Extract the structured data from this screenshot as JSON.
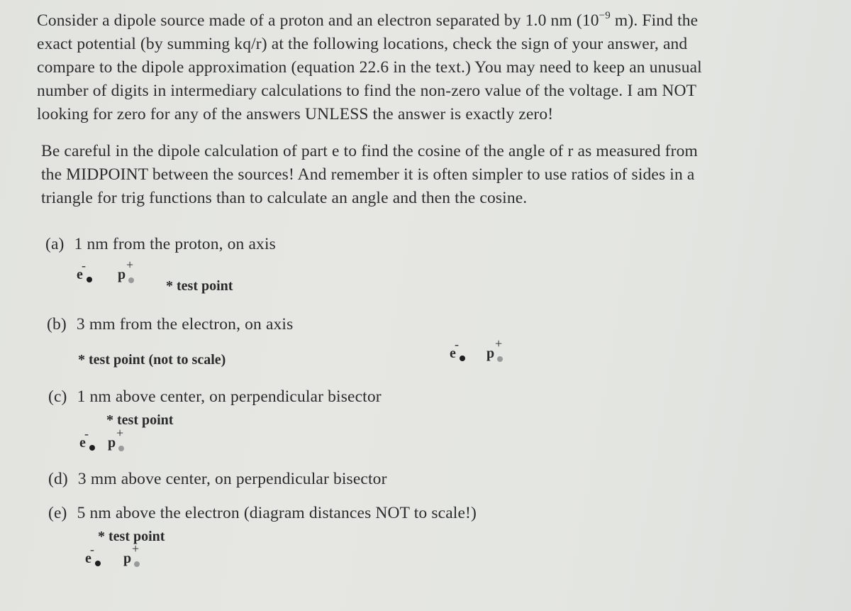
{
  "intro": {
    "lines": [
      [
        "Consider a dipole source made of a proton and an electron separated by 1.0 nm (10",
        "−9",
        " m).  Find the"
      ],
      [
        "exact potential (by summing kq/r) at the following locations, check the sign of your answer, and"
      ],
      [
        "compare to the dipole approximation (equation 22.6 in the text.)  You may need to keep an unusual"
      ],
      [
        "number of digits in intermediary calculations to find the non-zero value of the voltage.  I am NOT"
      ],
      [
        "looking for zero for any of the answers UNLESS the answer is exactly zero!"
      ]
    ]
  },
  "note": {
    "lines": [
      "Be careful in the dipole calculation of part e to find the cosine of the angle of r as measured from",
      "the MIDPOINT between the sources!  And remember it is often simpler to use ratios of sides in a",
      "triangle for trig functions than to calculate an angle and then the cosine."
    ]
  },
  "parts": [
    {
      "label": "(a)",
      "text": "1 nm from the proton, on axis",
      "test_point": "* test point"
    },
    {
      "label": "(b)",
      "text": "3 mm from the electron, on axis",
      "test_point": "* test point (not to scale)"
    },
    {
      "label": "(c)",
      "text": "1 nm above center, on perpendicular bisector",
      "test_point": "* test point"
    },
    {
      "label": "(d)",
      "text": "3 mm above center, on perpendicular bisector"
    },
    {
      "label": "(e)",
      "text": "5 nm above the electron (diagram distances NOT to scale!)",
      "test_point": "* test point"
    }
  ],
  "charges": {
    "electron": {
      "symbol": "e",
      "sign": "-",
      "dot_color": "#1e1e1e"
    },
    "proton": {
      "symbol": "p",
      "sign": "+",
      "dot_color": "#9a9a9a"
    }
  }
}
